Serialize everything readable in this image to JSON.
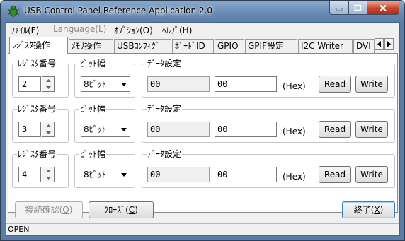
{
  "window": {
    "title": "USB Control Panel Reference Application 2.0"
  },
  "menu": [
    {
      "label": "ﾌｧｲﾙ(F)",
      "enabled": true
    },
    {
      "label": "Language(L)",
      "enabled": false
    },
    {
      "label": "ｵﾌﾟｼｮﾝ(O)",
      "enabled": true
    },
    {
      "label": "ﾍﾙﾌﾟ(H)",
      "enabled": true
    }
  ],
  "tabs": [
    {
      "label": "ﾚｼﾞｽﾀ操作",
      "active": true
    },
    {
      "label": "ﾒﾓﾘ操作",
      "active": false
    },
    {
      "label": "USBｺﾝﾌｨｸﾞ",
      "active": false
    },
    {
      "label": "ﾎﾞｰﾄﾞID",
      "active": false
    },
    {
      "label": "GPIO",
      "active": false
    },
    {
      "label": "GPIF設定",
      "active": false
    },
    {
      "label": "I2C Writer",
      "active": false
    },
    {
      "label": "DVI",
      "active": false
    }
  ],
  "labels": {
    "register_no": "ﾚｼﾞｽﾀ番号",
    "bit_width": "ﾋﾞｯﾄ幅",
    "data_setting": "ﾃﾞｰﾀ設定",
    "hex": "(Hex)",
    "read": "Read",
    "write": "Write"
  },
  "rows": [
    {
      "register": "2",
      "bit_width": "8ﾋﾞｯﾄ",
      "read_value": "00",
      "write_value": "00"
    },
    {
      "register": "3",
      "bit_width": "8ﾋﾞｯﾄ",
      "read_value": "00",
      "write_value": "00"
    },
    {
      "register": "4",
      "bit_width": "8ﾋﾞｯﾄ",
      "read_value": "00",
      "write_value": "00"
    }
  ],
  "buttons": {
    "connect_check": "接続確認(",
    "connect_check_key": "O",
    "connect_check_end": ")",
    "close": "ｸﾛｰｽﾞ(",
    "close_key": "C",
    "close_end": ")",
    "exit": "終了(",
    "exit_key": "X",
    "exit_end": ")"
  },
  "status": "OPEN",
  "colors": {
    "titlebar": "#6a8cb6",
    "close_button": "#c8452b",
    "panel_bg": "#ffffff"
  }
}
